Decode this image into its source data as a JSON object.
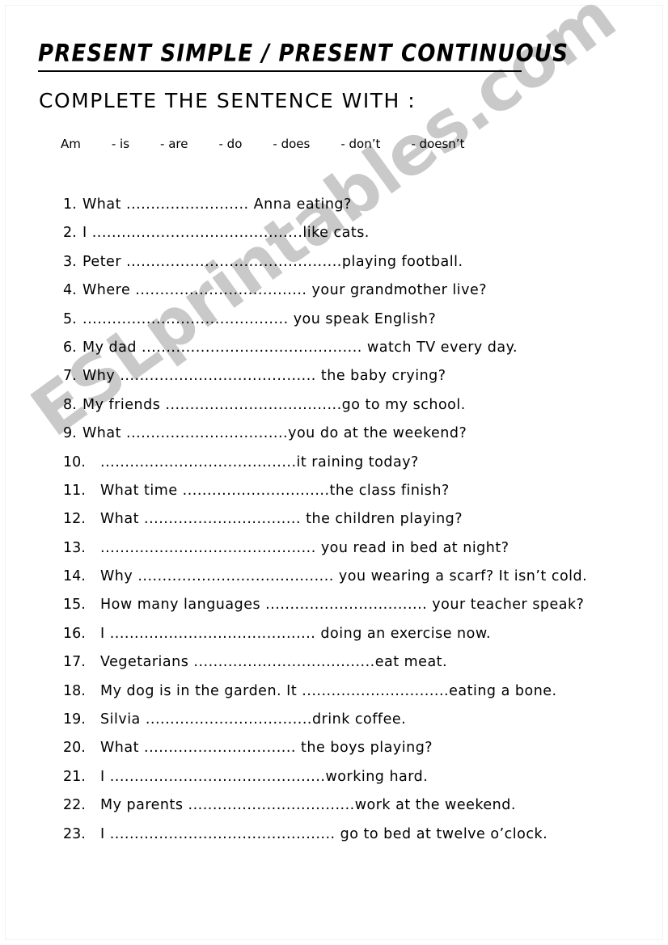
{
  "document": {
    "title": "PRESENT SIMPLE  / PRESENT CONTINUOUS",
    "subtitle": "COMPLETE  THE  SENTENCE  WITH :",
    "watermark": "ESLprintables.com",
    "watermark_color": "#c9c9c9",
    "text_color": "#000000",
    "background_color": "#ffffff"
  },
  "word_bank": {
    "words": [
      "Am",
      "- is",
      "- are",
      "- do",
      "- does",
      "- don’t",
      "- doesn’t"
    ]
  },
  "exercises": [
    {
      "number": "1.",
      "text": "What ......................... Anna eating?"
    },
    {
      "number": "2.",
      "text": "I ...........................................like cats."
    },
    {
      "number": "3.",
      "text": "Peter ............................................playing football."
    },
    {
      "number": "4.",
      "text": "Where ................................... your grandmother live?"
    },
    {
      "number": "5.",
      "text": "..........................................  you speak English?"
    },
    {
      "number": "6.",
      "text": "My dad ............................................. watch TV every day."
    },
    {
      "number": "7.",
      "text": "Why ........................................ the baby crying?"
    },
    {
      "number": "8.",
      "text": "My friends ....................................go to my school."
    },
    {
      "number": "9.",
      "text": "What .................................you do at the weekend?"
    },
    {
      "number": "10.",
      "text": "........................................it raining today?"
    },
    {
      "number": "11.",
      "text": "What time ..............................the class finish?"
    },
    {
      "number": "12.",
      "text": "What ................................ the children playing?"
    },
    {
      "number": "13.",
      "text": "............................................ you read in bed at night?"
    },
    {
      "number": "14.",
      "text": "Why ........................................ you wearing a scarf? It isn’t cold."
    },
    {
      "number": "15.",
      "text": "How many languages ................................. your teacher speak?"
    },
    {
      "number": "16.",
      "text": "I .......................................... doing an exercise now."
    },
    {
      "number": "17.",
      "text": "Vegetarians .....................................eat meat."
    },
    {
      "number": "18.",
      "text": "My dog is in the garden.  It ..............................eating a bone."
    },
    {
      "number": "19.",
      "text": "Silvia ..................................drink  coffee."
    },
    {
      "number": "20.",
      "text": "What ............................... the boys playing?"
    },
    {
      "number": "21.",
      "text": "I ............................................working hard."
    },
    {
      "number": "22.",
      "text": "My parents ..................................work at the weekend."
    },
    {
      "number": "23.",
      "text": "I .............................................. go to bed at twelve o’clock."
    }
  ]
}
